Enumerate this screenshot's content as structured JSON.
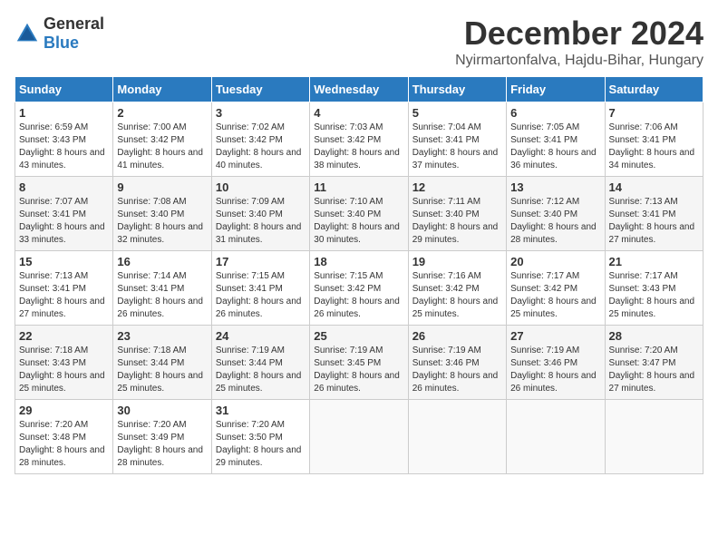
{
  "header": {
    "logo_general": "General",
    "logo_blue": "Blue",
    "month_year": "December 2024",
    "location": "Nyirmartonfalva, Hajdu-Bihar, Hungary"
  },
  "weekdays": [
    "Sunday",
    "Monday",
    "Tuesday",
    "Wednesday",
    "Thursday",
    "Friday",
    "Saturday"
  ],
  "weeks": [
    [
      {
        "day": "1",
        "sunrise": "6:59 AM",
        "sunset": "3:43 PM",
        "daylight": "8 hours and 43 minutes."
      },
      {
        "day": "2",
        "sunrise": "7:00 AM",
        "sunset": "3:42 PM",
        "daylight": "8 hours and 41 minutes."
      },
      {
        "day": "3",
        "sunrise": "7:02 AM",
        "sunset": "3:42 PM",
        "daylight": "8 hours and 40 minutes."
      },
      {
        "day": "4",
        "sunrise": "7:03 AM",
        "sunset": "3:42 PM",
        "daylight": "8 hours and 38 minutes."
      },
      {
        "day": "5",
        "sunrise": "7:04 AM",
        "sunset": "3:41 PM",
        "daylight": "8 hours and 37 minutes."
      },
      {
        "day": "6",
        "sunrise": "7:05 AM",
        "sunset": "3:41 PM",
        "daylight": "8 hours and 36 minutes."
      },
      {
        "day": "7",
        "sunrise": "7:06 AM",
        "sunset": "3:41 PM",
        "daylight": "8 hours and 34 minutes."
      }
    ],
    [
      {
        "day": "8",
        "sunrise": "7:07 AM",
        "sunset": "3:41 PM",
        "daylight": "8 hours and 33 minutes."
      },
      {
        "day": "9",
        "sunrise": "7:08 AM",
        "sunset": "3:40 PM",
        "daylight": "8 hours and 32 minutes."
      },
      {
        "day": "10",
        "sunrise": "7:09 AM",
        "sunset": "3:40 PM",
        "daylight": "8 hours and 31 minutes."
      },
      {
        "day": "11",
        "sunrise": "7:10 AM",
        "sunset": "3:40 PM",
        "daylight": "8 hours and 30 minutes."
      },
      {
        "day": "12",
        "sunrise": "7:11 AM",
        "sunset": "3:40 PM",
        "daylight": "8 hours and 29 minutes."
      },
      {
        "day": "13",
        "sunrise": "7:12 AM",
        "sunset": "3:40 PM",
        "daylight": "8 hours and 28 minutes."
      },
      {
        "day": "14",
        "sunrise": "7:13 AM",
        "sunset": "3:41 PM",
        "daylight": "8 hours and 27 minutes."
      }
    ],
    [
      {
        "day": "15",
        "sunrise": "7:13 AM",
        "sunset": "3:41 PM",
        "daylight": "8 hours and 27 minutes."
      },
      {
        "day": "16",
        "sunrise": "7:14 AM",
        "sunset": "3:41 PM",
        "daylight": "8 hours and 26 minutes."
      },
      {
        "day": "17",
        "sunrise": "7:15 AM",
        "sunset": "3:41 PM",
        "daylight": "8 hours and 26 minutes."
      },
      {
        "day": "18",
        "sunrise": "7:15 AM",
        "sunset": "3:42 PM",
        "daylight": "8 hours and 26 minutes."
      },
      {
        "day": "19",
        "sunrise": "7:16 AM",
        "sunset": "3:42 PM",
        "daylight": "8 hours and 25 minutes."
      },
      {
        "day": "20",
        "sunrise": "7:17 AM",
        "sunset": "3:42 PM",
        "daylight": "8 hours and 25 minutes."
      },
      {
        "day": "21",
        "sunrise": "7:17 AM",
        "sunset": "3:43 PM",
        "daylight": "8 hours and 25 minutes."
      }
    ],
    [
      {
        "day": "22",
        "sunrise": "7:18 AM",
        "sunset": "3:43 PM",
        "daylight": "8 hours and 25 minutes."
      },
      {
        "day": "23",
        "sunrise": "7:18 AM",
        "sunset": "3:44 PM",
        "daylight": "8 hours and 25 minutes."
      },
      {
        "day": "24",
        "sunrise": "7:19 AM",
        "sunset": "3:44 PM",
        "daylight": "8 hours and 25 minutes."
      },
      {
        "day": "25",
        "sunrise": "7:19 AM",
        "sunset": "3:45 PM",
        "daylight": "8 hours and 26 minutes."
      },
      {
        "day": "26",
        "sunrise": "7:19 AM",
        "sunset": "3:46 PM",
        "daylight": "8 hours and 26 minutes."
      },
      {
        "day": "27",
        "sunrise": "7:19 AM",
        "sunset": "3:46 PM",
        "daylight": "8 hours and 26 minutes."
      },
      {
        "day": "28",
        "sunrise": "7:20 AM",
        "sunset": "3:47 PM",
        "daylight": "8 hours and 27 minutes."
      }
    ],
    [
      {
        "day": "29",
        "sunrise": "7:20 AM",
        "sunset": "3:48 PM",
        "daylight": "8 hours and 28 minutes."
      },
      {
        "day": "30",
        "sunrise": "7:20 AM",
        "sunset": "3:49 PM",
        "daylight": "8 hours and 28 minutes."
      },
      {
        "day": "31",
        "sunrise": "7:20 AM",
        "sunset": "3:50 PM",
        "daylight": "8 hours and 29 minutes."
      },
      null,
      null,
      null,
      null
    ]
  ]
}
